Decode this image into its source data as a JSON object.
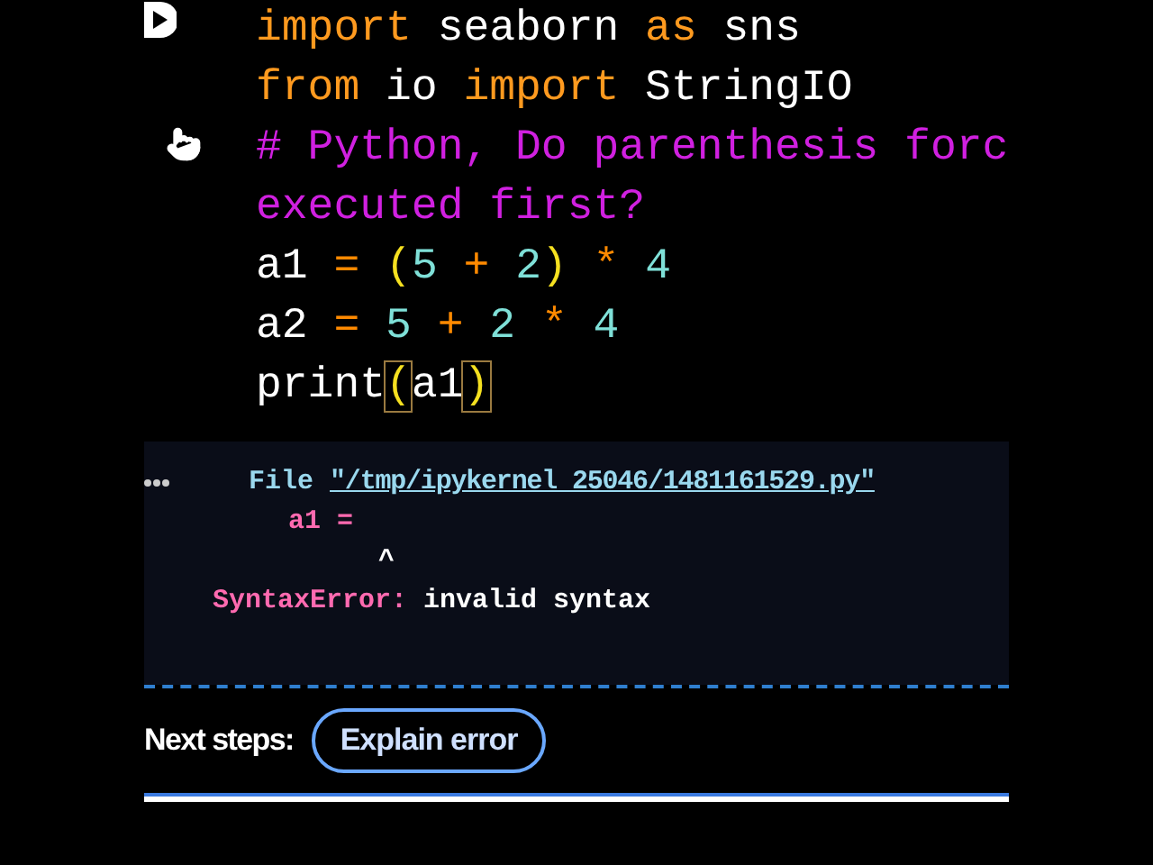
{
  "code_cell": {
    "lines": [
      {
        "tokens": [
          {
            "text": "import",
            "kind": "keyword"
          },
          {
            "text": " seaborn ",
            "kind": "name"
          },
          {
            "text": "as",
            "kind": "keyword"
          },
          {
            "text": " sns",
            "kind": "name"
          }
        ]
      },
      {
        "tokens": [
          {
            "text": "from",
            "kind": "keyword"
          },
          {
            "text": " io ",
            "kind": "name"
          },
          {
            "text": "import",
            "kind": "keyword"
          },
          {
            "text": " StringIO",
            "kind": "name"
          }
        ]
      },
      {
        "tokens": [
          {
            "text": "# Python, Do parenthesis forc",
            "kind": "comment"
          }
        ]
      },
      {
        "tokens": [
          {
            "text": "executed first?",
            "kind": "comment"
          }
        ]
      },
      {
        "tokens": [
          {
            "text": "a1 ",
            "kind": "name"
          },
          {
            "text": "= ",
            "kind": "operator"
          },
          {
            "text": "(",
            "kind": "bracket"
          },
          {
            "text": "5 ",
            "kind": "number"
          },
          {
            "text": "+ ",
            "kind": "operator"
          },
          {
            "text": "2",
            "kind": "number"
          },
          {
            "text": ")",
            "kind": "bracket"
          },
          {
            "text": " * ",
            "kind": "operator"
          },
          {
            "text": "4",
            "kind": "number"
          }
        ]
      },
      {
        "tokens": [
          {
            "text": "a2 ",
            "kind": "name"
          },
          {
            "text": "= ",
            "kind": "operator"
          },
          {
            "text": "5 ",
            "kind": "number"
          },
          {
            "text": "+ ",
            "kind": "operator"
          },
          {
            "text": "2 ",
            "kind": "number"
          },
          {
            "text": "* ",
            "kind": "operator"
          },
          {
            "text": "4",
            "kind": "number"
          }
        ]
      },
      {
        "tokens": [
          {
            "text": "print",
            "kind": "name"
          },
          {
            "text": "(",
            "kind": "matched"
          },
          {
            "text": "a1",
            "kind": "name"
          },
          {
            "text": ")",
            "kind": "matched"
          }
        ]
      }
    ]
  },
  "output": {
    "file_label": "File",
    "file_path": "\"/tmp/ipykernel 25046/1481161529.py\"",
    "code_line": "a1 =",
    "caret": "^",
    "error_name": "SyntaxError:",
    "error_message": "invalid syntax"
  },
  "next_steps": {
    "label": "Next steps:",
    "button": "Explain error"
  }
}
